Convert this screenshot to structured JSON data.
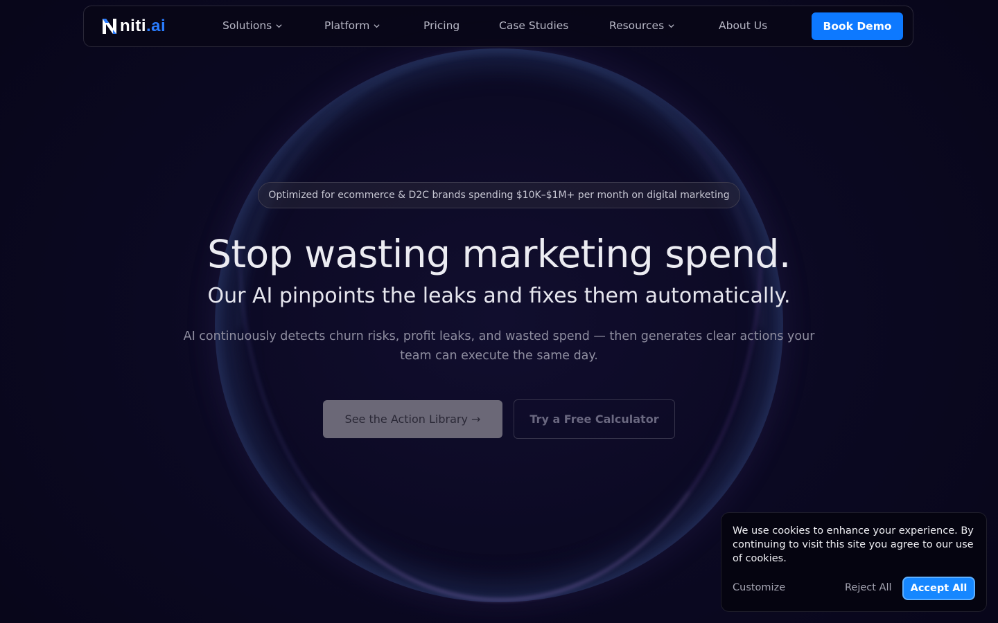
{
  "brand": {
    "name_main": "niti",
    "name_accent": ".ai",
    "logo_icon": "niti-logo-icon",
    "accent_color": "#0d79ff"
  },
  "nav": {
    "items": [
      {
        "label": "Solutions",
        "has_dropdown": true
      },
      {
        "label": "Platform",
        "has_dropdown": true
      },
      {
        "label": "Pricing",
        "has_dropdown": false
      },
      {
        "label": "Case Studies",
        "has_dropdown": false
      },
      {
        "label": "Resources",
        "has_dropdown": true
      },
      {
        "label": "About Us",
        "has_dropdown": false
      }
    ],
    "cta_label": "Book Demo"
  },
  "hero": {
    "badge": "Optimized for ecommerce & D2C brands spending $10K–$1M+ per month on digital marketing",
    "title": "Stop wasting marketing spend.",
    "subtitle": "Our AI pinpoints the leaks and fixes them automatically.",
    "description": "AI continuously detects churn risks, profit leaks, and wasted spend — then generates clear actions your team can execute the same day.",
    "primary_button": "See the Action Library →",
    "secondary_button": "Try a Free Calculator"
  },
  "cookie_banner": {
    "message": "We use cookies to enhance your experience. By continuing to visit this site you agree to our use of cookies.",
    "customize_label": "Customize",
    "reject_label": "Reject All",
    "accept_label": "Accept All",
    "accept_color": "#1687ff"
  }
}
